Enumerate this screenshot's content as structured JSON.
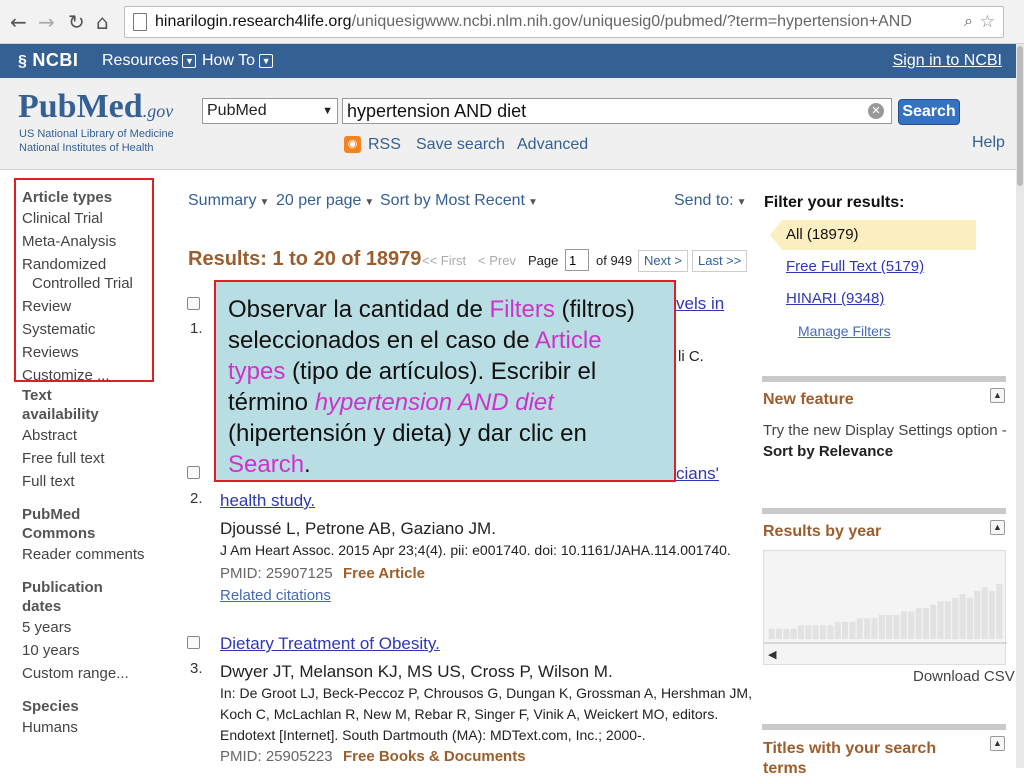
{
  "browser": {
    "url_host": "hinarilogin.research4life.org",
    "url_path": "/uniquesigwww.ncbi.nlm.nih.gov/uniquesig0/pubmed/?term=hypertension+AND"
  },
  "ncbi_bar": {
    "logo": "NCBI",
    "menu_resources": "Resources",
    "menu_howto": "How To",
    "sign_in": "Sign in to NCBI"
  },
  "header": {
    "logo_main": "PubMed",
    "logo_gov": ".gov",
    "logo_sub1": "US National Library of Medicine",
    "logo_sub2": "National Institutes of Health",
    "database": "PubMed",
    "search_value": "hypertension AND diet",
    "search_button": "Search",
    "rss": "RSS",
    "save_search": "Save search",
    "advanced": "Advanced",
    "help": "Help"
  },
  "left_filters": {
    "article_types": {
      "title": "Article types",
      "items": [
        "Clinical Trial",
        "Meta-Analysis",
        "Randomized",
        "Controlled Trial",
        "Review",
        "Systematic Reviews",
        "Customize ..."
      ]
    },
    "text_availability": {
      "title1": "Text",
      "title2": "availability",
      "items": [
        "Abstract",
        "Free full text",
        "Full text"
      ]
    },
    "pubmed_commons": {
      "title1": "PubMed",
      "title2": "Commons",
      "items": [
        "Reader comments"
      ]
    },
    "publication_dates": {
      "title1": "Publication",
      "title2": "dates",
      "items": [
        "5 years",
        "10 years",
        "Custom range..."
      ]
    },
    "species": {
      "title": "Species",
      "items": [
        "Humans"
      ]
    }
  },
  "toolbar": {
    "summary": "Summary",
    "per_page": "20 per page",
    "sort": "Sort by Most Recent",
    "send_to": "Send to:"
  },
  "results": {
    "count_text": "Results: 1 to 20 of 18979",
    "first": "<< First",
    "prev": "< Prev",
    "page_label": "Page",
    "page_value": "1",
    "of_pages": "of 949",
    "next": "Next >",
    "last": "Last >>",
    "items": [
      {
        "num": "1.",
        "title_fragment": "vels in",
        "author_fragment": "li C."
      },
      {
        "num": "2.",
        "title_fragment": "cians'",
        "title_line2": "health study.",
        "authors": "Djoussé L, Petrone AB, Gaziano JM.",
        "cite": "J Am Heart Assoc. 2015 Apr 23;4(4). pii: e001740. doi: 10.1161/JAHA.114.001740.",
        "pmid": "PMID: 25907125",
        "free": "Free Article",
        "related": "Related citations"
      },
      {
        "num": "3.",
        "title": "Dietary Treatment of Obesity.",
        "authors": "Dwyer JT, Melanson KJ, MS US, Cross P, Wilson M.",
        "cite1": "In: De Groot LJ, Beck-Peccoz P, Chrousos G, Dungan K, Grossman A, Hershman JM,",
        "cite2": "Koch C, McLachlan R, New M, Rebar R, Singer F, Vinik A, Weickert MO, editors.",
        "cite3": "Endotext [Internet]. South Dartmouth (MA): MDText.com, Inc.; 2000-.",
        "pmid": "PMID: 25905223",
        "free": "Free Books & Documents"
      }
    ]
  },
  "callout": {
    "t1": "Observar la cantidad de ",
    "h1": "Filters",
    "t2": " (filtros) seleccionados en el caso de ",
    "h2": "Article types",
    "t3": " (tipo de artículos). Escribir el término ",
    "h3": "hypertension AND diet",
    "t4": " (hipertensión y dieta) y dar clic en ",
    "h4": "Search",
    "t5": "."
  },
  "right_sidebar": {
    "filter_title": "Filter your results:",
    "all": "All (18979)",
    "free_full_text": "Free Full Text (5179)",
    "hinari": "HINARI (9348)",
    "manage": "Manage Filters",
    "new_feature_title": "New feature",
    "new_feature_text": "Try the new Display Settings option -",
    "new_feature_bold": "Sort by Relevance",
    "results_by_year": "Results by year",
    "download_csv": "Download CSV",
    "titles_with_search": "Titles with your search",
    "titles_with_search_2": "terms"
  },
  "chart_data": {
    "type": "bar",
    "values": [
      3,
      3,
      3,
      3,
      4,
      4,
      4,
      4,
      4,
      5,
      5,
      5,
      6,
      6,
      6,
      7,
      7,
      7,
      8,
      8,
      9,
      9,
      10,
      11,
      11,
      12,
      13,
      12,
      14,
      15,
      14,
      16
    ],
    "color": "#e2e2e2"
  },
  "colors": {
    "ncbi_bar": "#346094",
    "highlight": "#cc33cc",
    "callout_bg": "#b8dde3",
    "callout_border": "#e01c24"
  }
}
